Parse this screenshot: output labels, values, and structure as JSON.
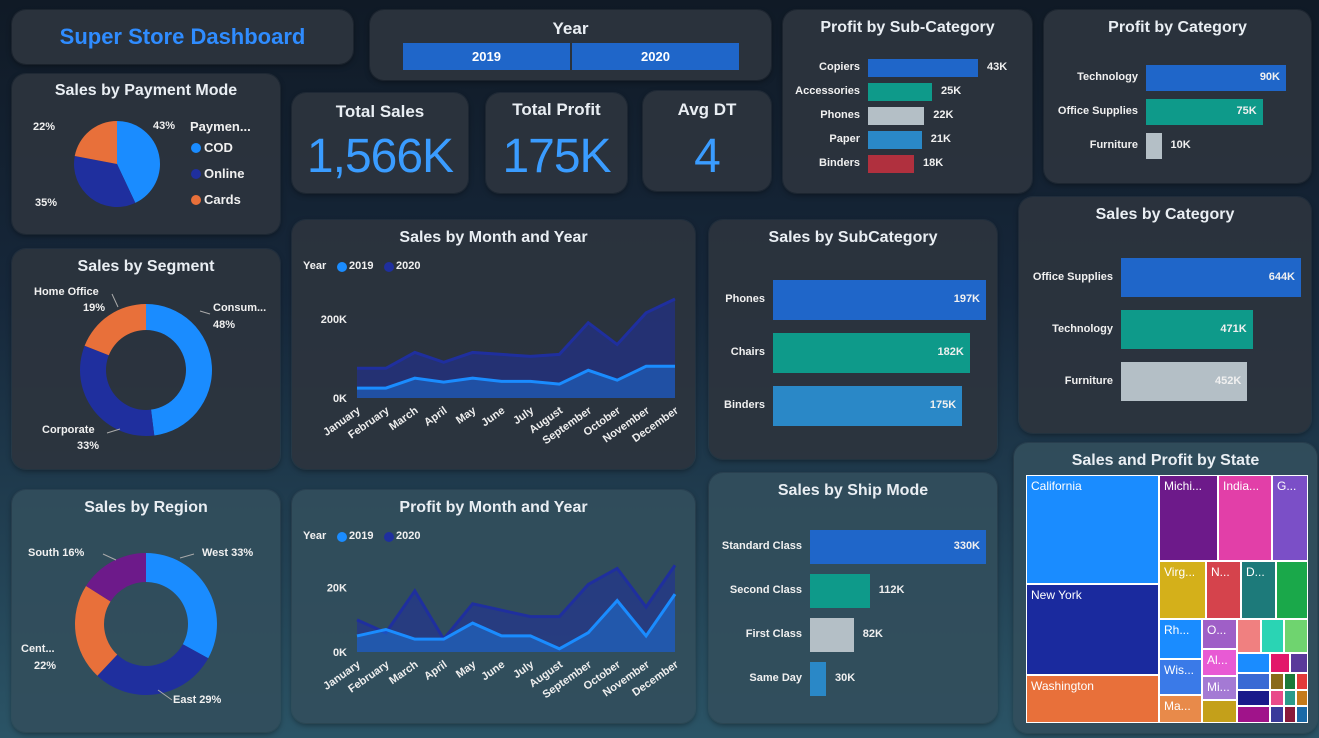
{
  "header": {
    "title": "Super Store Dashboard"
  },
  "year_slicer": {
    "title": "Year",
    "options": [
      "2019",
      "2020"
    ]
  },
  "kpis": [
    {
      "label": "Total Sales",
      "value": "1,566K"
    },
    {
      "label": "Total Profit",
      "value": "175K"
    },
    {
      "label": "Avg DT",
      "value": "4"
    }
  ],
  "payment_mode": {
    "title": "Sales by Payment Mode",
    "legend_title": "Paymen...",
    "slices": [
      {
        "name": "COD",
        "pct": 43,
        "label": "43%",
        "color": "#1a8cff"
      },
      {
        "name": "Online",
        "pct": 35,
        "label": "35%",
        "color": "#1f2f9e"
      },
      {
        "name": "Cards",
        "pct": 22,
        "label": "22%",
        "color": "#e8703a"
      }
    ]
  },
  "segment": {
    "title": "Sales by Segment",
    "slices": [
      {
        "name": "Consum...",
        "pct": 48,
        "pct_label": "48%",
        "color": "#1a8cff"
      },
      {
        "name": "Corporate",
        "pct": 33,
        "pct_label": "33%",
        "color": "#1f2f9e"
      },
      {
        "name": "Home Office",
        "pct": 19,
        "pct_label": "19%",
        "color": "#e8703a"
      }
    ]
  },
  "region": {
    "title": "Sales by Region",
    "slices": [
      {
        "name": "West",
        "pct": 33,
        "label": "West 33%",
        "color": "#1a8cff"
      },
      {
        "name": "East",
        "pct": 29,
        "label": "East 29%",
        "color": "#1f2f9e"
      },
      {
        "name": "Cent...",
        "pct": 22,
        "label": "22%",
        "color": "#e8703a"
      },
      {
        "name": "South",
        "pct": 16,
        "label": "South 16%",
        "color": "#6d1a8a"
      }
    ]
  },
  "profit_subcat": {
    "title": "Profit by Sub-Category",
    "items": [
      {
        "name": "Copiers",
        "value": 43,
        "label": "43K",
        "color": "#1f66c9"
      },
      {
        "name": "Accessories",
        "value": 25,
        "label": "25K",
        "color": "#0e9a8a"
      },
      {
        "name": "Phones",
        "value": 22,
        "label": "22K",
        "color": "#b4bfc6"
      },
      {
        "name": "Paper",
        "value": 21,
        "label": "21K",
        "color": "#2a88c7"
      },
      {
        "name": "Binders",
        "value": 18,
        "label": "18K",
        "color": "#b0303e"
      }
    ]
  },
  "profit_category": {
    "title": "Profit by Category",
    "items": [
      {
        "name": "Technology",
        "value": 90,
        "label": "90K",
        "color": "#1f66c9"
      },
      {
        "name": "Office Supplies",
        "value": 75,
        "label": "75K",
        "color": "#0e9a8a"
      },
      {
        "name": "Furniture",
        "value": 10,
        "label": "10K",
        "color": "#b4bfc6"
      }
    ]
  },
  "sales_category": {
    "title": "Sales by Category",
    "items": [
      {
        "name": "Office Supplies",
        "value": 644,
        "label": "644K",
        "color": "#1f66c9"
      },
      {
        "name": "Technology",
        "value": 471,
        "label": "471K",
        "color": "#0e9a8a"
      },
      {
        "name": "Furniture",
        "value": 452,
        "label": "452K",
        "color": "#b4bfc6"
      }
    ]
  },
  "sales_subcat": {
    "title": "Sales by SubCategory",
    "items": [
      {
        "name": "Phones",
        "value": 197,
        "label": "197K",
        "color": "#1f66c9"
      },
      {
        "name": "Chairs",
        "value": 182,
        "label": "182K",
        "color": "#0e9a8a"
      },
      {
        "name": "Binders",
        "value": 175,
        "label": "175K",
        "color": "#2a88c7"
      }
    ]
  },
  "ship_mode": {
    "title": "Sales by Ship Mode",
    "items": [
      {
        "name": "Standard Class",
        "value": 330,
        "label": "330K",
        "color": "#1f66c9"
      },
      {
        "name": "Second Class",
        "value": 112,
        "label": "112K",
        "color": "#0e9a8a"
      },
      {
        "name": "First Class",
        "value": 82,
        "label": "82K",
        "color": "#b4bfc6"
      },
      {
        "name": "Same Day",
        "value": 30,
        "label": "30K",
        "color": "#2a88c7"
      }
    ]
  },
  "legend": {
    "title": "Year",
    "s2019": "2019",
    "s2020": "2020"
  },
  "chart_data": [
    {
      "type": "area",
      "title": "Sales by Month and Year",
      "categories": [
        "January",
        "February",
        "March",
        "April",
        "May",
        "June",
        "July",
        "August",
        "September",
        "October",
        "November",
        "December"
      ],
      "yticks": [
        "200K",
        "0K"
      ],
      "ylim": [
        0,
        260
      ],
      "series": [
        {
          "name": "2020",
          "values": [
            75,
            75,
            115,
            90,
            115,
            110,
            105,
            110,
            190,
            135,
            215,
            250
          ],
          "color": "#1f2f9e"
        },
        {
          "name": "2019",
          "values": [
            25,
            25,
            50,
            40,
            50,
            42,
            42,
            35,
            70,
            45,
            80,
            80
          ],
          "color": "#1a8cff"
        }
      ]
    },
    {
      "type": "area",
      "title": "Profit by Month and Year",
      "categories": [
        "January",
        "February",
        "March",
        "April",
        "May",
        "June",
        "July",
        "August",
        "September",
        "October",
        "November",
        "December"
      ],
      "yticks": [
        "20K",
        "0K"
      ],
      "ylim": [
        0,
        28
      ],
      "series": [
        {
          "name": "2020",
          "values": [
            10,
            6,
            19,
            4,
            15,
            13,
            11,
            11,
            21,
            26,
            14,
            27
          ],
          "color": "#1f2f9e"
        },
        {
          "name": "2019",
          "values": [
            5,
            7,
            4,
            4,
            9,
            5,
            5,
            1,
            6,
            16,
            5,
            18
          ],
          "color": "#1a8cff"
        }
      ]
    }
  ],
  "state_map": {
    "title": "Sales and Profit by State",
    "labels": [
      "California",
      "New York",
      "Washington",
      "Michi...",
      "India...",
      "G...",
      "Virg...",
      "N...",
      "D...",
      "Rh...",
      "O...",
      "Al...",
      "Wis...",
      "Mi...",
      "Ma..."
    ]
  }
}
